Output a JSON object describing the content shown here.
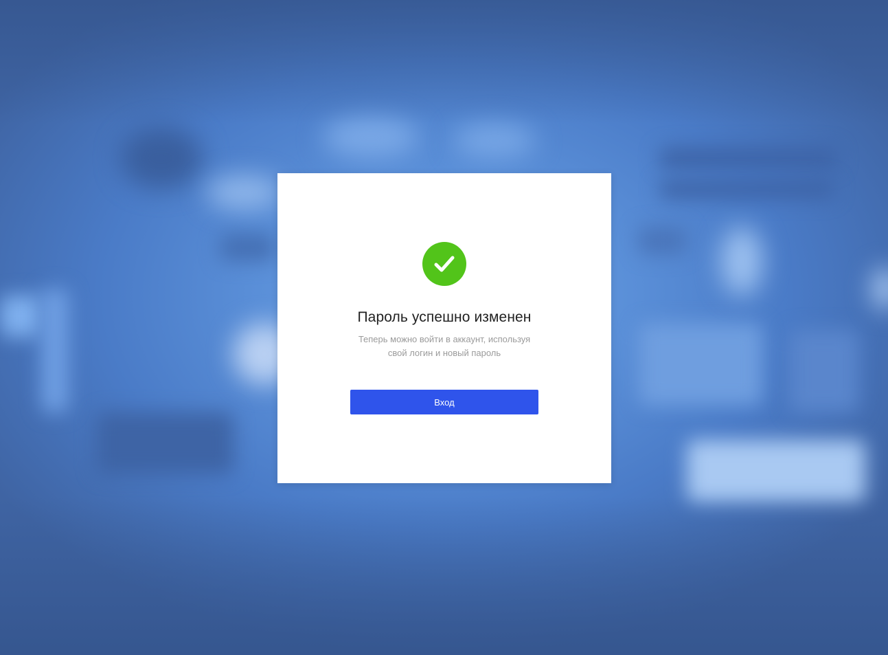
{
  "dialog": {
    "icon": "check-circle-icon",
    "title": "Пароль успешно изменен",
    "message_line1": "Теперь можно войти в аккаунт, используя",
    "message_line2": "свой логин и новый пароль",
    "login_button_label": "Вход"
  },
  "colors": {
    "success": "#52c41a",
    "primary": "#2f54eb",
    "background": "#5a8fd8"
  }
}
